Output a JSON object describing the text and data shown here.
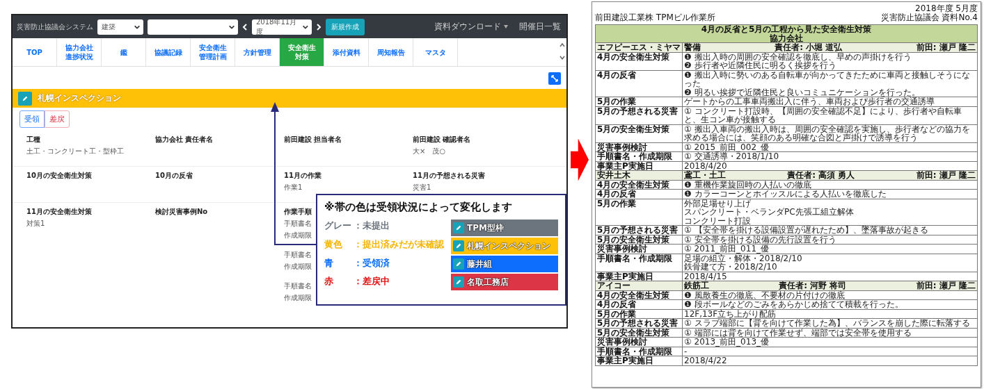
{
  "app": {
    "title": "災害防止協議会システム",
    "selects": [
      {
        "kind": "short",
        "value": "建築"
      },
      {
        "kind": "wide"
      },
      {
        "kind": "month",
        "value": "2018年11月度"
      }
    ],
    "new_button": "新規作成",
    "menu": [
      {
        "label": "資料ダウンロード",
        "dropdown": true
      },
      {
        "label": "開催日一覧",
        "dropdown": false
      }
    ],
    "tabs": [
      {
        "lines": [
          "TOP"
        ],
        "selected": false
      },
      {
        "lines": [
          "協力会社",
          "進捗状況"
        ],
        "selected": false
      },
      {
        "lines": [
          "鑑"
        ],
        "selected": false
      },
      {
        "lines": [
          "協議記録"
        ],
        "selected": false
      },
      {
        "lines": [
          "安全衛生",
          "管理計画"
        ],
        "selected": false
      },
      {
        "lines": [
          "方針管理"
        ],
        "selected": false
      },
      {
        "lines": [
          "安全衛生",
          "対策"
        ],
        "selected": true
      },
      {
        "lines": [
          "添付資料"
        ],
        "selected": false
      },
      {
        "lines": [
          "周知報告"
        ],
        "selected": false
      },
      {
        "lines": [
          "マスタ"
        ],
        "selected": false
      }
    ],
    "band": {
      "label": "札幌インスペクション",
      "color": "#ffc107"
    },
    "actions": [
      {
        "label": "受領",
        "kind": "accept"
      },
      {
        "label": "差戻",
        "kind": "reject"
      }
    ],
    "field_rows": [
      [
        {
          "label": "工種",
          "values": [
            "土工・コンクリート工・型枠工"
          ]
        },
        {
          "label": "協力会社 責任者名"
        },
        {
          "label": "前田建設 担当者名"
        },
        {
          "label": "前田建設 確認者名",
          "values": [
            "大×　茂○"
          ]
        }
      ],
      [
        {
          "label": "10月の安全衛生対策"
        },
        {
          "label": "10月の反省"
        },
        {
          "label": "11月の作業",
          "values": [
            "作業1"
          ]
        },
        {
          "label": "11月の予想される災害",
          "values": [
            "災害1"
          ]
        }
      ],
      [
        {
          "label": "11月の安全衛生対策",
          "values": [
            "対策1"
          ]
        },
        {
          "label": "検討災害事例No"
        },
        {
          "label": "作業手順",
          "groups": [
            [
              "手順書名",
              "作成期限"
            ],
            [
              "手順書名",
              "作成期限"
            ],
            [
              "手順書名",
              "作成期限"
            ]
          ]
        }
      ]
    ],
    "callout": {
      "title": "※帯の色は受領状況によって変化します",
      "legend": [
        {
          "term": "グレー",
          "desc": "：未提出",
          "color": "#6c757d"
        },
        {
          "term": "黄色",
          "desc": "：提出済みだが未確認",
          "color": "#f5b400"
        },
        {
          "term": "青",
          "desc": "：受領済",
          "color": "#0d6efd"
        },
        {
          "term": "赤",
          "desc": "：差戻中",
          "color": "#e01010"
        }
      ],
      "samples": [
        {
          "label": "TPM型枠",
          "color": "#6c757d"
        },
        {
          "label": "札幌インスペクション",
          "color": "#ffc107"
        },
        {
          "label": "藤井組",
          "color": "#0d6efd"
        },
        {
          "label": "名取工務店",
          "color": "#dc3545"
        }
      ]
    }
  },
  "document": {
    "header_left": "前田建設工業株 TPMビル作業所",
    "header_right": [
      "2018年度 5月度",
      "災害防止協議会 資料No.4"
    ],
    "title": [
      "4月の反省と5月の工程から見た安全衛生対策",
      "協力会社"
    ],
    "sections": [
      {
        "company": "エフピーエス・ミヤマ",
        "trade": "警備",
        "manager": "責任者: 小堀 道弘",
        "maeda": "前田: 瀬戸 隆二",
        "rows": [
          {
            "label": "4月の安全衛生対策",
            "lines": [
              "❶ 搬出入時の周囲の安全確認を徹底し、早めの声掛けを行う",
              "❷ 歩行者や近隣住民に明るく挨拶を行う"
            ]
          },
          {
            "label": "4月の反省",
            "lines": [
              "❶ 搬出入時に勢いのある自転車が向かってきたために車両と接触しそうになった",
              "❷ 明るい挨拶で近隣住民と良いコミュニケーションを行った。"
            ]
          },
          {
            "label": "5月の作業",
            "lines": [
              "ゲートからの工事車両搬出入に伴う、車両および歩行者の交通誘導"
            ]
          },
          {
            "label": "5月の予想される災害",
            "lines": [
              "① コンクリート打設時、【周囲の安全確認不足】により、歩行者や自転車と、生コン車が接触する"
            ]
          },
          {
            "label": "5月の安全衛生対策",
            "lines": [
              "① 搬出入車両の搬出入時は、周囲の安全確認を実施し、歩行者などの協力を求める場合には、笑顔のある明確な合図と声掛けで誘導を行う"
            ]
          },
          {
            "label": "災害事例検討",
            "lines": [
              "① 2015_前田_002_優"
            ]
          },
          {
            "label": "手順書名・作成期限",
            "lines": [
              "① 交通誘導・2018/1/10"
            ]
          },
          {
            "label": "事業主P実施日",
            "lines": [
              "2018/4/20"
            ]
          }
        ]
      },
      {
        "company": "安井土木",
        "trade": "鳶工・土工",
        "manager": "責任者: 高須 勇人",
        "maeda": "前田: 瀬戸 隆二",
        "rows": [
          {
            "label": "4月の安全衛生対策",
            "lines": [
              "❶ 重機作業旋回時の人払いの徹底"
            ]
          },
          {
            "label": "4月の反省",
            "lines": [
              "❶ カラーコーンとホイッスルによる人払いを徹底した"
            ]
          },
          {
            "label": "5月の作業",
            "lines": [
              "外部足場せり上げ",
              "スパンクリート・ベランダPC先張工組立解体",
              "コンクリート打設"
            ]
          },
          {
            "label": "5月の予想される災害",
            "lines": [
              "① 【安全帯を掛ける設備設置が遅れたため】、墜落事故が起きる"
            ]
          },
          {
            "label": "5月の安全衛生対策",
            "lines": [
              "① 安全帯を掛ける設備の先行設置を行う"
            ]
          },
          {
            "label": "災害事例検討",
            "lines": [
              "① 2011_前田_011_優"
            ]
          },
          {
            "label": "手順書名・作成期限",
            "lines": [
              "足場の組立・解体・2018/2/10",
              "鉄骨建て方・2018/2/10"
            ]
          },
          {
            "label": "事業主P実施日",
            "lines": [
              "2018/4/15"
            ]
          }
        ]
      },
      {
        "company": "アイコー",
        "trade": "鉄筋工",
        "manager": "責任者: 河野 将司",
        "maeda": "前田: 瀬戸 隆二",
        "rows": [
          {
            "label": "4月の安全衛生対策",
            "lines": [
              "❶ 風散養生の徹底、不要材の片付けの徹底"
            ]
          },
          {
            "label": "4月の反省",
            "lines": [
              "❶ 段ボールなどのごみをあらかじめ捨てて積載を行った。"
            ]
          },
          {
            "label": "5月の作業",
            "lines": [
              "12F,13F立ち上がり配筋"
            ]
          },
          {
            "label": "5月の予想される災害",
            "lines": [
              "① スラブ端部に【背を向けて作業した為】、バランスを崩した際に転落する"
            ]
          },
          {
            "label": "5月の安全衛生対策",
            "lines": [
              "① 端部には背を向けて作業せず、端部では安全帯を使用する"
            ]
          },
          {
            "label": "災害事例検討",
            "lines": [
              "① 2013_前田_013_優"
            ]
          },
          {
            "label": "手順書名・作成期限",
            "lines": [
              "-"
            ]
          },
          {
            "label": "事業主P実施日",
            "lines": [
              "2018/4/22"
            ]
          }
        ]
      }
    ]
  }
}
